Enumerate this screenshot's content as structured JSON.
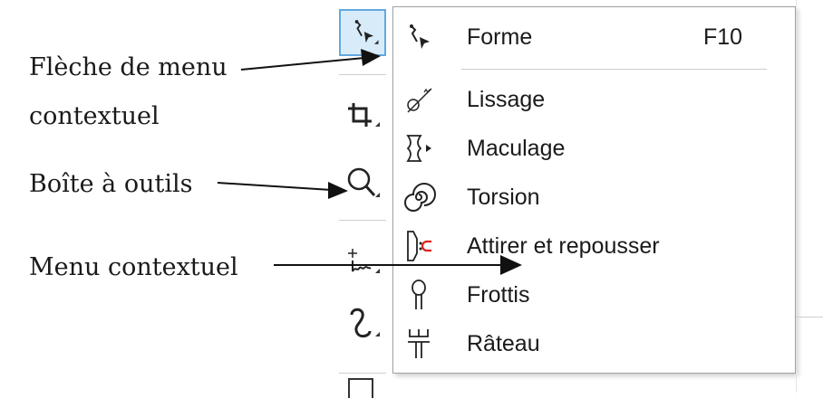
{
  "annotations": {
    "fleche_line1": "Flèche de menu",
    "fleche_line2": "contextuel",
    "boite": "Boîte à outils",
    "menu": "Menu contextuel"
  },
  "toolbox": {
    "tools": [
      {
        "icon": "shape-tool-icon",
        "active": true
      },
      {
        "icon": "crop-tool-icon",
        "active": false
      },
      {
        "icon": "zoom-tool-icon",
        "active": false
      },
      {
        "icon": "freehand-tool-icon",
        "active": false
      },
      {
        "icon": "artistic-media-icon",
        "active": false
      }
    ]
  },
  "flyout": {
    "items": [
      {
        "icon": "shape-icon",
        "label": "Forme",
        "shortcut": "F10"
      },
      {
        "icon": "smooth-icon",
        "label": "Lissage"
      },
      {
        "icon": "smear-icon",
        "label": "Maculage"
      },
      {
        "icon": "twirl-icon",
        "label": "Torsion"
      },
      {
        "icon": "attract-repel-icon",
        "label": "Attirer et repousser"
      },
      {
        "icon": "smudge-icon",
        "label": "Frottis"
      },
      {
        "icon": "roughen-icon",
        "label": "Râteau"
      }
    ]
  },
  "colors": {
    "active_tool_bg": "#d8ebf9",
    "active_tool_border": "#62a9e0",
    "attract_repel_accent": "#e0201a"
  }
}
